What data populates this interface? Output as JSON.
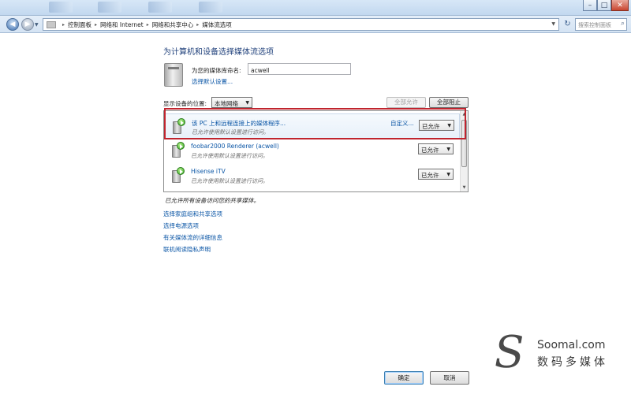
{
  "address_bar": {
    "breadcrumbs": [
      "控制面板",
      "网络和 Internet",
      "网络和共享中心",
      "媒体流选项"
    ],
    "search_placeholder": "搜索控制面板"
  },
  "page": {
    "title": "为计算机和设备选择媒体流选项",
    "library_name_label": "为您的媒体库命名:",
    "library_name_value": "acwell",
    "choose_defaults_link": "选择默认设置...",
    "show_devices_label": "显示设备的位置:",
    "show_devices_value": "本地网络",
    "allow_all_button": "全部允许",
    "block_all_button": "全部阻止"
  },
  "devices": [
    {
      "name": "该 PC 上和远程连接上的媒体程序...",
      "description": "已允许使用默认设置进行访问。",
      "customize_link": "自定义...",
      "permission": "已允许"
    },
    {
      "name": "foobar2000 Renderer (acwell)",
      "description": "已允许使用默认设置进行访问。",
      "permission": "已允许"
    },
    {
      "name": "Hisense iTV",
      "description": "已允许使用默认设置进行访问。",
      "permission": "已允许"
    }
  ],
  "all_allowed_text": "已允许所有设备访问您的共享媒体。",
  "links": [
    "选择家庭组和共享选项",
    "选择电源选项",
    "有关媒体流的详细信息",
    "联机阅读隐私声明"
  ],
  "footer": {
    "ok_button": "确定",
    "cancel_button": "取消"
  },
  "watermark": {
    "brand": "Soomal.com",
    "subtitle": "数码多媒体"
  },
  "colors": {
    "link": "#0b56a6",
    "title": "#1e3f7a",
    "highlight_border": "#c0242e"
  }
}
